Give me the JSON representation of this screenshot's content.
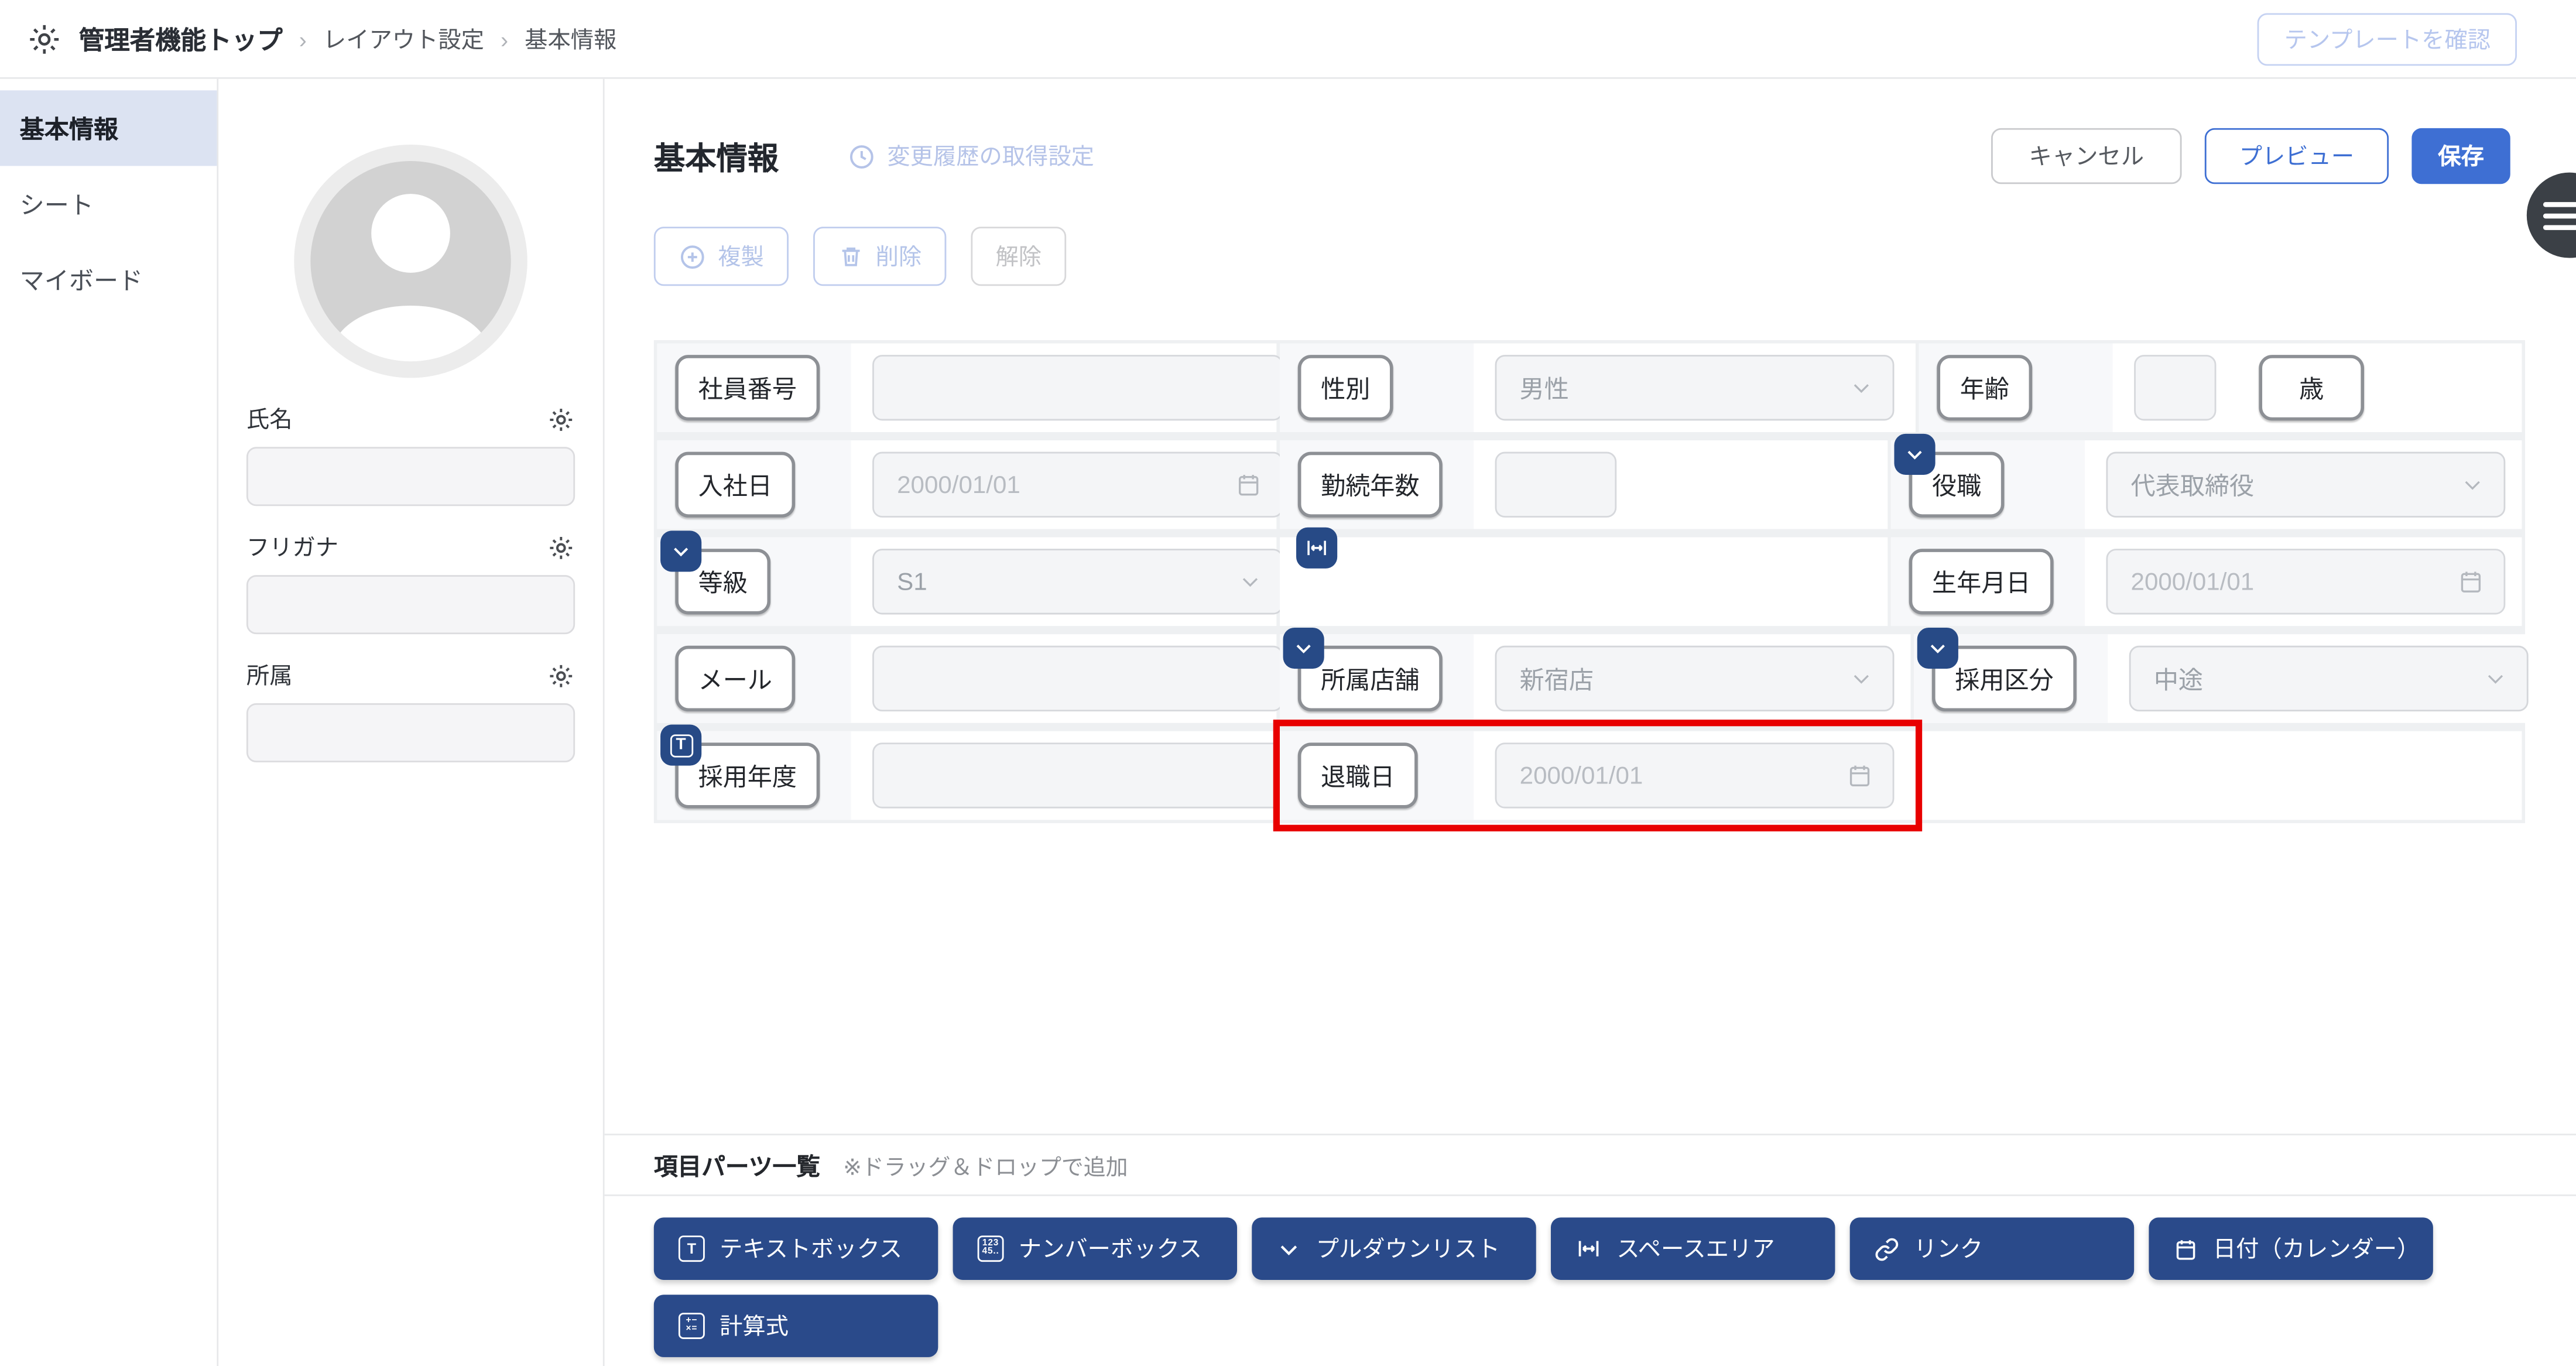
{
  "header": {
    "breadcrumb": [
      "管理者機能トップ",
      "レイアウト設定",
      "基本情報"
    ],
    "template_button": "テンプレートを確認"
  },
  "sidebar": {
    "items": [
      {
        "label": "基本情報",
        "active": true
      },
      {
        "label": "シート",
        "active": false
      },
      {
        "label": "マイボード",
        "active": false
      }
    ]
  },
  "profile": {
    "fields": [
      {
        "label": "氏名",
        "value": ""
      },
      {
        "label": "フリガナ",
        "value": ""
      },
      {
        "label": "所属",
        "value": ""
      }
    ]
  },
  "main": {
    "title": "基本情報",
    "history_link": "変更履歴の取得設定",
    "cancel": "キャンセル",
    "preview": "プレビュー",
    "save": "保存",
    "toolbar": {
      "duplicate": "複製",
      "delete": "削除",
      "release": "解除"
    }
  },
  "grid": {
    "rows": [
      {
        "cells": [
          {
            "label": "社員番号",
            "field": "text",
            "value": ""
          },
          {
            "label": "性別",
            "field": "select",
            "value": "男性"
          },
          {
            "label": "年齢",
            "field": "number",
            "value": "",
            "suffix": "歳"
          }
        ]
      },
      {
        "cells": [
          {
            "label": "入社日",
            "field": "date",
            "placeholder": "2000/01/01"
          },
          {
            "label": "勤続年数",
            "field": "number",
            "value": ""
          },
          {
            "label": "役職",
            "badge": "dropdown",
            "field": "select",
            "value": "代表取締役"
          }
        ]
      },
      {
        "cells": [
          {
            "label": "等級",
            "badge": "dropdown",
            "field": "select",
            "value": "S1"
          },
          {
            "badge": "space",
            "field": "none"
          },
          {
            "label": "生年月日",
            "field": "date",
            "placeholder": "2000/01/01"
          }
        ]
      },
      {
        "cells": [
          {
            "label": "メール",
            "field": "text",
            "value": ""
          },
          {
            "label": "所属店舗",
            "badge": "dropdown",
            "field": "select",
            "value": "新宿店"
          },
          {
            "label": "採用区分",
            "badge": "dropdown",
            "field": "select",
            "value": "中途"
          }
        ]
      },
      {
        "cells": [
          {
            "label": "採用年度",
            "badge": "textbox",
            "field": "text",
            "value": ""
          },
          {
            "label": "退職日",
            "field": "date",
            "placeholder": "2000/01/01",
            "highlighted": true
          },
          {
            "field": "empty"
          }
        ]
      }
    ]
  },
  "parts": {
    "title": "項目パーツ一覧",
    "note": "※ドラッグ＆ドロップで追加",
    "items": [
      {
        "label": "テキストボックス",
        "icon": "textbox-icon"
      },
      {
        "label": "ナンバーボックス",
        "icon": "numberbox-icon"
      },
      {
        "label": "プルダウンリスト",
        "icon": "chevron-down-icon"
      },
      {
        "label": "スペースエリア",
        "icon": "space-area-icon"
      },
      {
        "label": "リンク",
        "icon": "link-icon"
      },
      {
        "label": "日付（カレンダー）",
        "icon": "calendar-icon"
      },
      {
        "label": "計算式",
        "icon": "calculator-icon"
      }
    ]
  },
  "colors": {
    "navy": "#2a4a8a",
    "primary_blue": "#3e6fd3",
    "light_blue": "#b6c6ee",
    "highlight_red": "#e80000",
    "sidebar_active_bg": "#dce3f2"
  }
}
